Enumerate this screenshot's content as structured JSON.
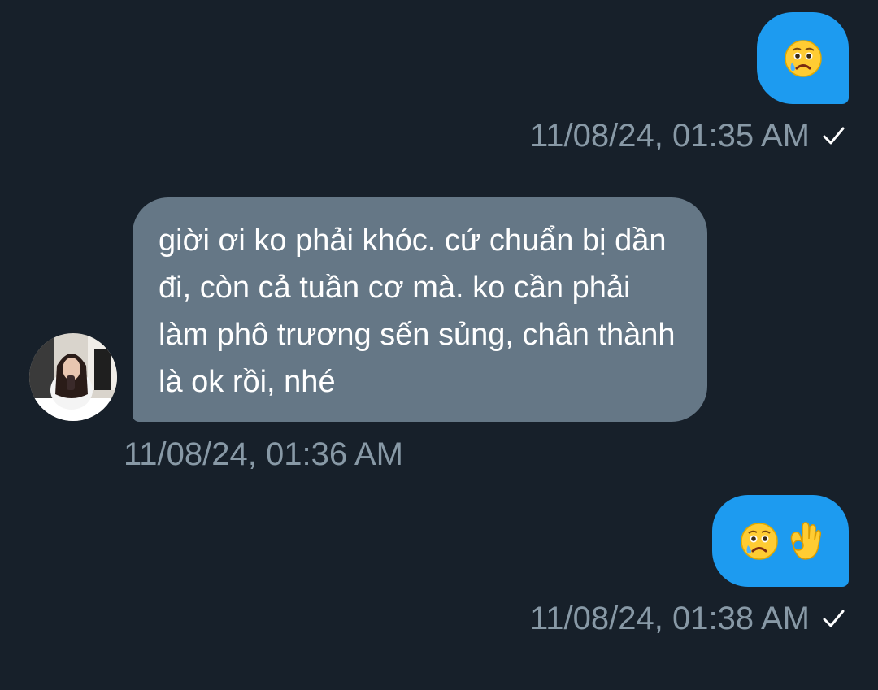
{
  "conversation": {
    "messages": [
      {
        "sender": "me",
        "emojis": [
          "crying-face"
        ],
        "timestamp": "11/08/24, 01:35 AM",
        "status": "sent"
      },
      {
        "sender": "contact",
        "text": "giời ơi ko phải khóc. cứ chuẩn bị dần đi, còn cả tuần cơ mà. ko cần phải làm phô trương sến sủng, chân thành là ok rồi, nhé",
        "timestamp": "11/08/24, 01:36 AM"
      },
      {
        "sender": "me",
        "emojis": [
          "crying-face",
          "ok-hand"
        ],
        "timestamp": "11/08/24, 01:38 AM",
        "status": "sent"
      }
    ]
  },
  "colors": {
    "background": "#17202a",
    "outgoing_bubble": "#1d9bf0",
    "incoming_bubble": "#657786",
    "timestamp_text": "#8899a6"
  }
}
